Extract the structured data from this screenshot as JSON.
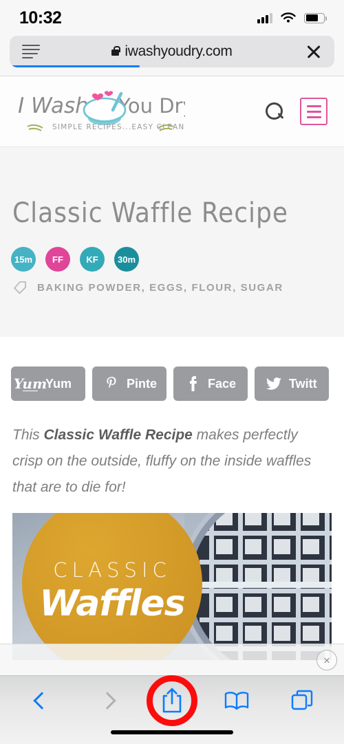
{
  "status_bar": {
    "time": "10:32",
    "signal_icon": "cellular-signal-icon",
    "wifi_icon": "wifi-icon",
    "battery_icon": "battery-icon",
    "battery_level": 72,
    "signal_bars_filled": 3
  },
  "browser": {
    "reader_icon": "reader-mode-icon",
    "lock_icon": "lock-icon",
    "url": "iwashyoudry.com",
    "close_icon": "close-icon",
    "loading_progress_percent": 40,
    "progress_color": "#0a7cff"
  },
  "site_header": {
    "logo_line1": "I Wash",
    "logo_line2": "You Dry",
    "logo_tagline": "SIMPLE RECIPES...EASY CLEANUP",
    "search_icon": "search-icon",
    "menu_icon": "hamburger-menu-icon",
    "accent_color": "#e0559a",
    "logo_bowl_color": "#6cc5d4"
  },
  "hero": {
    "title": "Classic Waffle Recipe",
    "badges": [
      {
        "label": "15m",
        "color": "#45b3c4"
      },
      {
        "label": "FF",
        "color": "#e0459a"
      },
      {
        "label": "KF",
        "color": "#33aab8"
      },
      {
        "label": "30m",
        "color": "#1b8e9c"
      }
    ],
    "tag_icon": "tag-icon",
    "tags": "BAKING POWDER, EGGS, FLOUR, SUGAR",
    "background_color": "#f5f5f5"
  },
  "share_buttons": [
    {
      "label": "Yum",
      "icon": "yum-icon",
      "glyph": "Yum"
    },
    {
      "label": "Pinte",
      "icon": "pinterest-icon",
      "glyph": "P"
    },
    {
      "label": "Face",
      "icon": "facebook-icon",
      "glyph": "f"
    },
    {
      "label": "Twitt",
      "icon": "twitter-icon",
      "glyph": "✈"
    }
  ],
  "share_button_color": "#9b9ca0",
  "intro": {
    "before": "This ",
    "bold": "Classic Waffle Recipe",
    "after": " makes perfectly crisp on the outside, fluffy on the inside waffles that are to die for!"
  },
  "recipe_image": {
    "badge_line1": "CLASSIC",
    "badge_line2": "Waffles",
    "badge_color": "#d49b28",
    "alt": "round waffle iron"
  },
  "ad_overlay": {
    "close_icon": "close-icon",
    "close_glyph": "×"
  },
  "toolbar": {
    "back_icon": "back-chevron-icon",
    "forward_icon": "forward-chevron-icon",
    "share_icon": "share-icon",
    "bookmarks_icon": "bookmarks-book-icon",
    "tabs_icon": "tabs-icon",
    "active_color": "#0a7cff",
    "disabled_color": "#b0b0b2",
    "highlight_ring_color": "#fb0d0d",
    "highlighted_button": "share-icon"
  }
}
